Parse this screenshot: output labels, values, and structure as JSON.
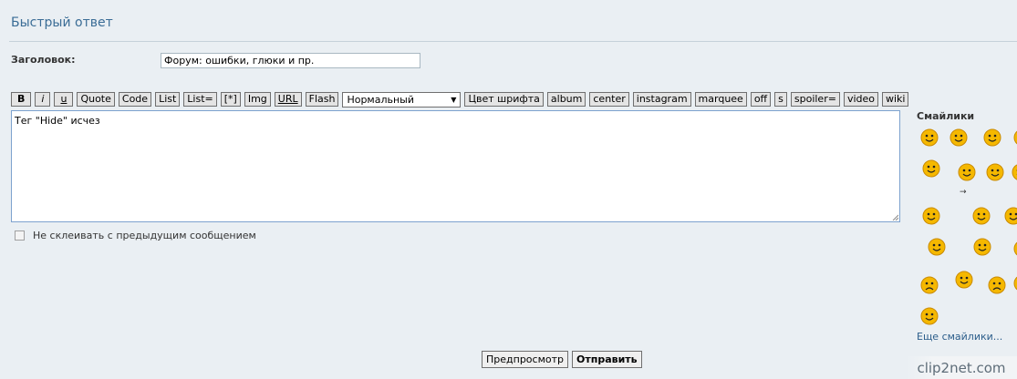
{
  "header": {
    "title": "Быстрый ответ"
  },
  "subject": {
    "label": "Заголовок:",
    "value": "Форум: ошибки, глюки и пр."
  },
  "toolbar": {
    "buttons_left": [
      {
        "label": "B",
        "style": "b"
      },
      {
        "label": "i",
        "style": "i"
      },
      {
        "label": "u",
        "style": "u"
      },
      {
        "label": "Quote",
        "style": ""
      },
      {
        "label": "Code",
        "style": ""
      },
      {
        "label": "List",
        "style": ""
      },
      {
        "label": "List=",
        "style": ""
      },
      {
        "label": "[*]",
        "style": ""
      },
      {
        "label": "Img",
        "style": ""
      },
      {
        "label": "URL",
        "style": "url"
      },
      {
        "label": "Flash",
        "style": ""
      }
    ],
    "size_select": {
      "value": "Нормальный"
    },
    "buttons_right": [
      {
        "label": "Цвет шрифта"
      },
      {
        "label": "album"
      },
      {
        "label": "center"
      },
      {
        "label": "instagram"
      },
      {
        "label": "marquee"
      },
      {
        "label": "off"
      },
      {
        "label": "s"
      },
      {
        "label": "spoiler="
      },
      {
        "label": "video"
      },
      {
        "label": "wiki"
      }
    ]
  },
  "editor": {
    "text": "Тег \"Hide\" исчез"
  },
  "merge_option": {
    "label": "Не склеивать с предыдущим сообщением",
    "checked": false
  },
  "smilies": {
    "title": "Смайлики",
    "more_label": "Еще смайлики...",
    "arrow_label": "→",
    "icons": [
      "smile-icon",
      "wink-icon",
      "grin-icon",
      "happy-icon",
      "dizzy-icon",
      "shy-icon",
      "angel-icon",
      "happy-icon",
      "weed-icon",
      "gun-icon",
      "shocked-icon",
      "happy-icon",
      "cop-icon",
      "clap-icon",
      "happy-icon",
      "sad-icon",
      "facepalm-icon",
      "cry-icon",
      "teeth-icon"
    ]
  },
  "actions": {
    "preview_label": "Предпросмотр",
    "submit_label": "Отправить"
  },
  "watermark": {
    "text": "clip2net.com"
  },
  "colors": {
    "title": "#3b6d96",
    "face": "#f5b800",
    "face_dark": "#c98a00",
    "link": "#2b5d8a"
  }
}
